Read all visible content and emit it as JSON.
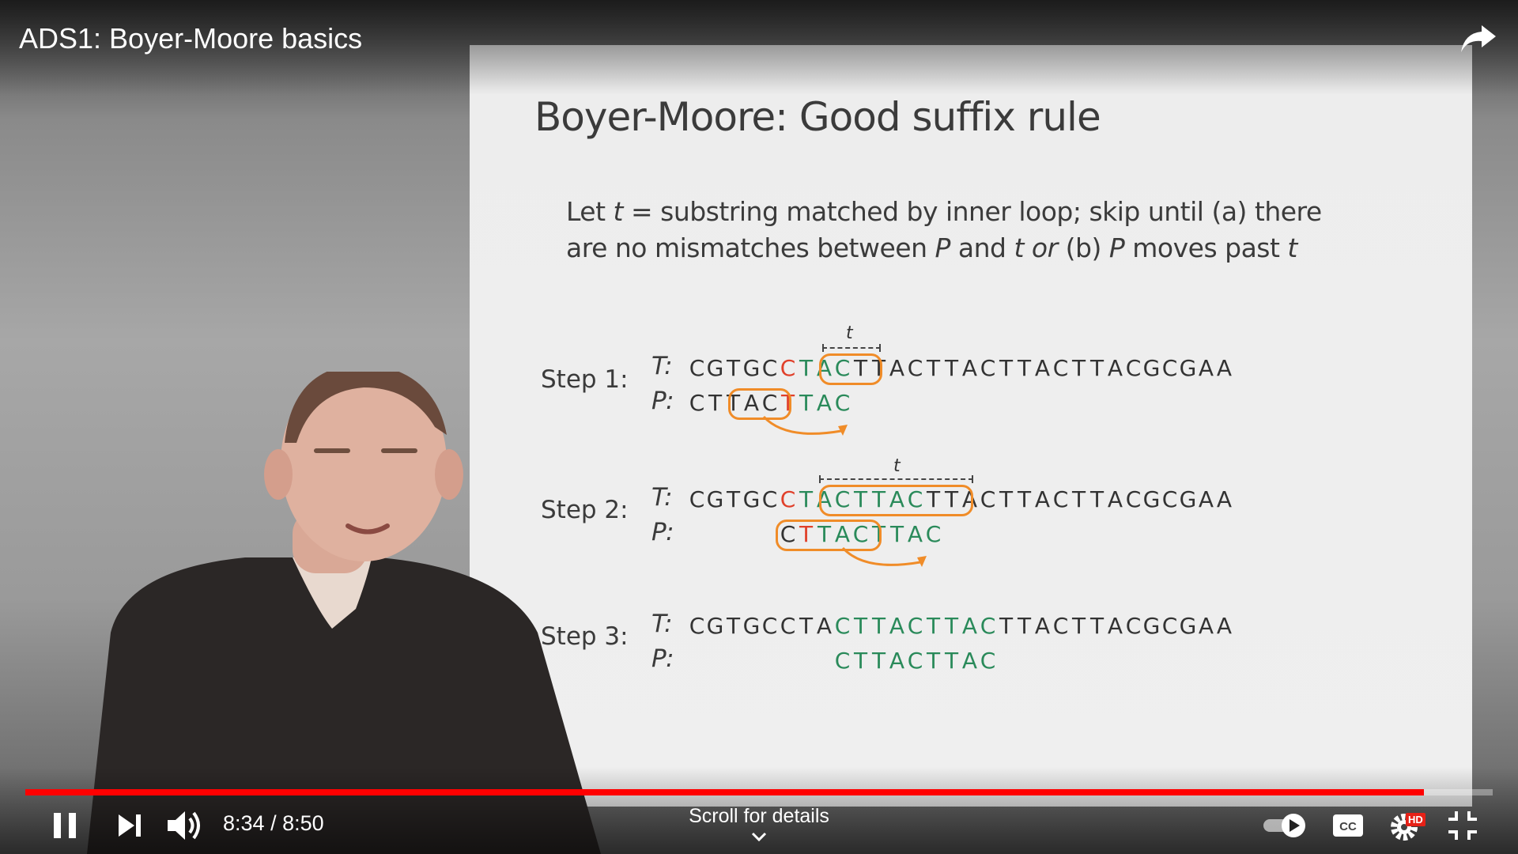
{
  "player": {
    "video_title": "ADS1: Boyer-Moore basics",
    "time_current": "8:34",
    "time_separator": " / ",
    "time_total": "8:50",
    "progress_fraction": 0.953,
    "scroll_hint": "Scroll for details",
    "quality_badge": "HD"
  },
  "slide": {
    "title": "Boyer-Moore: Good suffix rule",
    "desc_line1_a": "Let ",
    "desc_t": "t",
    "desc_line1_b": " = substring matched by inner loop; skip until (a) there",
    "desc_line2_a": "are no mismatches between ",
    "desc_P": "P",
    "desc_line2_b": " and ",
    "desc_t2": "t",
    "desc_or": " or",
    "desc_line2_c": " (b) ",
    "desc_P2": "P",
    "desc_line2_d": " moves past ",
    "desc_t3": "t",
    "t_row_label": "T:",
    "p_row_label": "P:",
    "t_marker": "t",
    "steps": [
      {
        "label": "Step 1:"
      },
      {
        "label": "Step 2:"
      },
      {
        "label": "Step 3:"
      }
    ]
  },
  "colors": {
    "match_green": "#2a8a5a",
    "mismatch_red": "#e0402a",
    "highlight_orange": "#f08c28",
    "progress_red": "#ff0000"
  },
  "icons": [
    "share-icon",
    "pause-icon",
    "next-icon",
    "volume-icon",
    "autoplay-toggle-icon",
    "captions-icon",
    "settings-icon",
    "exit-fullscreen-icon",
    "chevron-down-icon"
  ]
}
